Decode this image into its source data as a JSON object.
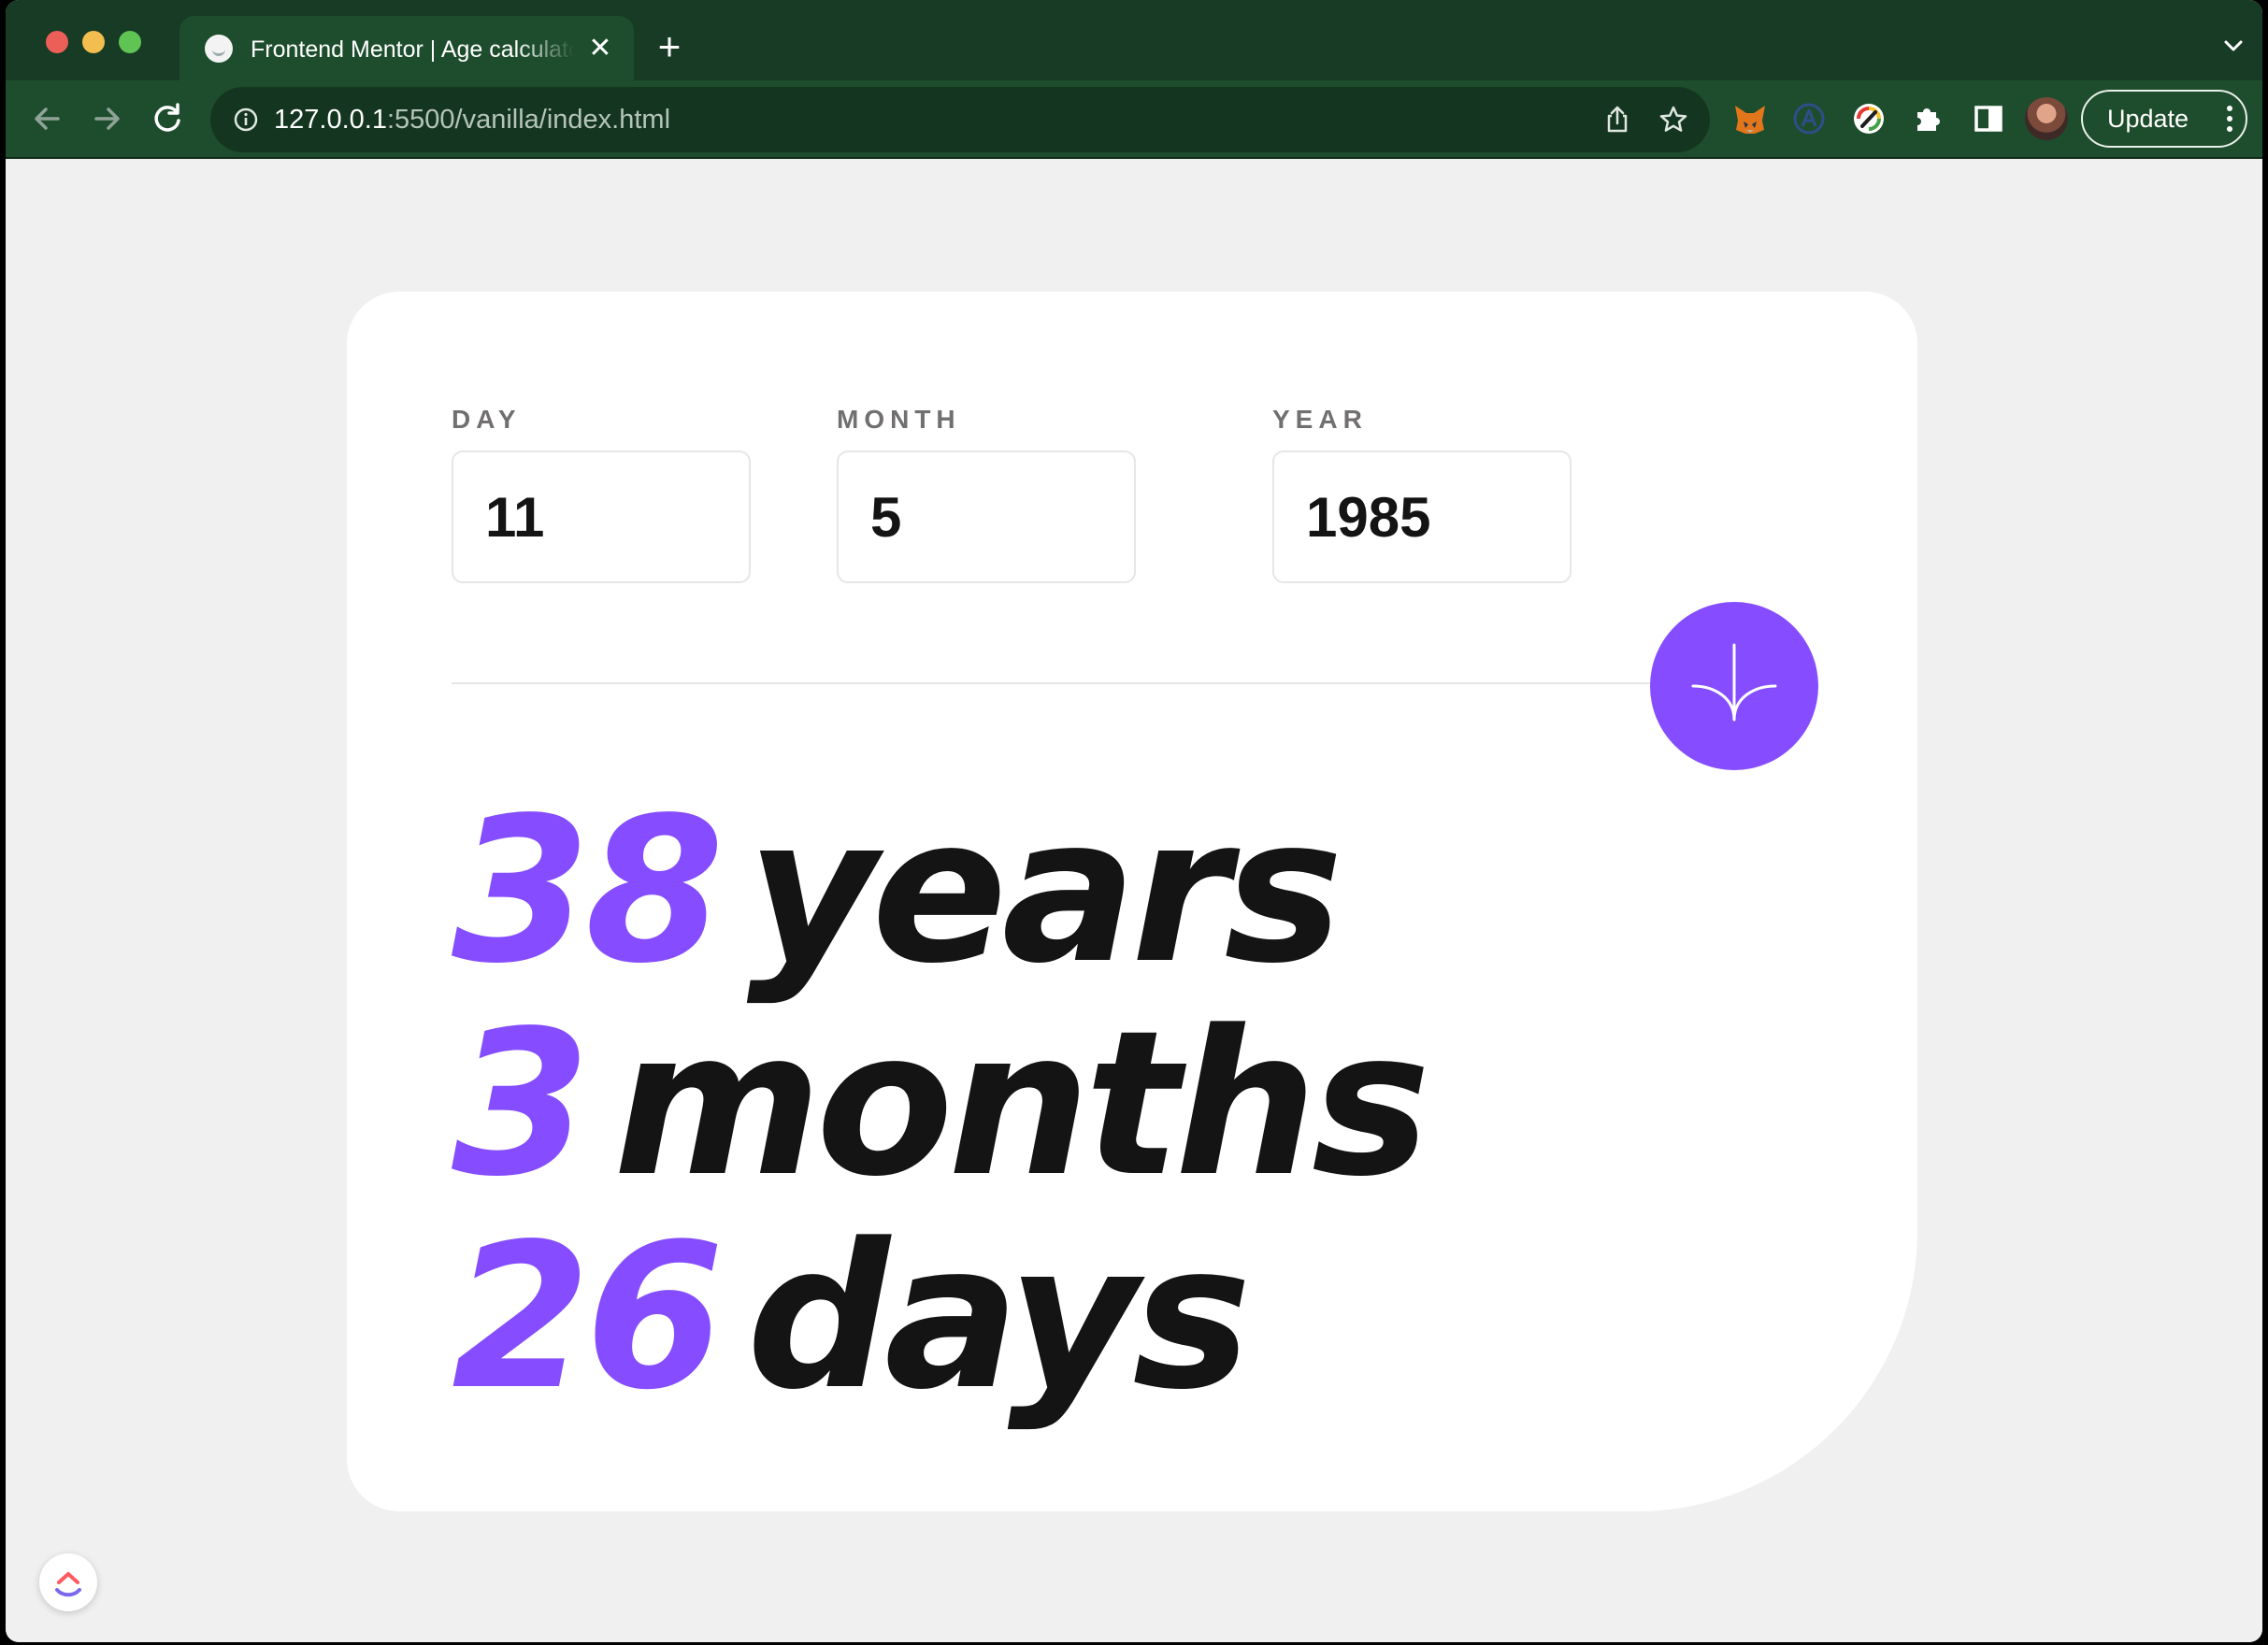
{
  "browser": {
    "tab_title": "Frontend Mentor | Age calculator app",
    "url_host": "127.0.0.1",
    "url_rest": ":5500/vanilla/index.html",
    "update_label": "Update"
  },
  "form": {
    "day": {
      "label": "DAY",
      "value": "11"
    },
    "month": {
      "label": "MONTH",
      "value": "5"
    },
    "year": {
      "label": "YEAR",
      "value": "1985"
    }
  },
  "results": {
    "years": {
      "value": "38",
      "unit": "years"
    },
    "months": {
      "value": "3",
      "unit": "months"
    },
    "days": {
      "value": "26",
      "unit": "days"
    }
  },
  "colors": {
    "accent": "#854dff",
    "text_dark": "#141414",
    "label_gray": "#716f6f",
    "browser_frame": "#1d4d2c",
    "page_bg": "#f0f0f0"
  },
  "icons": [
    "arrow-down-icon",
    "info-icon",
    "share-icon",
    "star-icon",
    "metamask-fox-icon",
    "extension-a-icon",
    "extension-pen-icon",
    "puzzle-icon",
    "side-panel-icon",
    "clickup-icon"
  ]
}
